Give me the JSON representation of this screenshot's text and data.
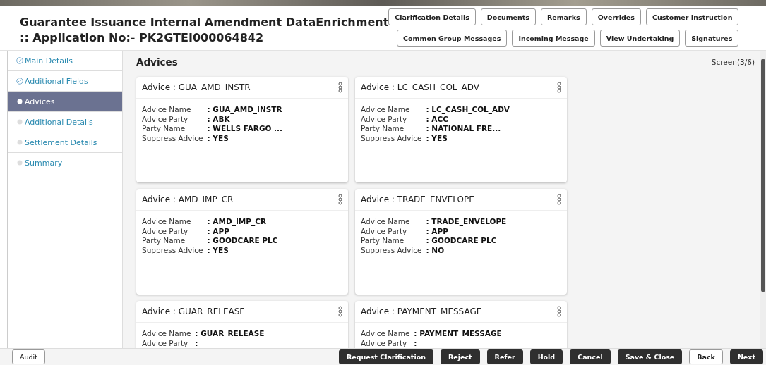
{
  "header": {
    "title": "Guarantee Issuance Internal Amendment DataEnrichment",
    "subtitle": ":: Application No:- PK2GTEI000064842",
    "button_rows": [
      [
        "Clarification Details",
        "Documents",
        "Remarks",
        "Overrides",
        "Customer Instruction"
      ],
      [
        "Common Group Messages",
        "Incoming Message",
        "View Undertaking",
        "Signatures"
      ]
    ]
  },
  "sidebar": {
    "items": [
      {
        "label": "Main Details",
        "completed": true,
        "selected": false
      },
      {
        "label": "Additional Fields",
        "completed": true,
        "selected": false
      },
      {
        "label": "Advices",
        "completed": false,
        "selected": true
      },
      {
        "label": "Additional Details",
        "completed": false,
        "selected": false
      },
      {
        "label": "Settlement Details",
        "completed": false,
        "selected": false
      },
      {
        "label": "Summary",
        "completed": false,
        "selected": false
      }
    ]
  },
  "content": {
    "title": "Advices",
    "screen": "Screen(3/6)",
    "cards": [
      {
        "title": "Advice : GUA_AMD_INSTR",
        "fields": [
          {
            "label": "Advice Name",
            "value": ": GUA_AMD_INSTR"
          },
          {
            "label": "Advice Party",
            "value": ": ABK"
          },
          {
            "label": "Party Name",
            "value": ": WELLS FARGO ..."
          },
          {
            "label": "Suppress Advice",
            "value": ": YES"
          }
        ]
      },
      {
        "title": "Advice : LC_CASH_COL_ADV",
        "fields": [
          {
            "label": "Advice Name",
            "value": ": LC_CASH_COL_ADV"
          },
          {
            "label": "Advice Party",
            "value": ": ACC"
          },
          {
            "label": "Party Name",
            "value": ": NATIONAL FRE..."
          },
          {
            "label": "Suppress Advice",
            "value": ": YES"
          }
        ]
      },
      {
        "title": "Advice : AMD_IMP_CR",
        "fields": [
          {
            "label": "Advice Name",
            "value": ": AMD_IMP_CR"
          },
          {
            "label": "Advice Party",
            "value": ": APP"
          },
          {
            "label": "Party Name",
            "value": ": GOODCARE PLC"
          },
          {
            "label": "Suppress Advice",
            "value": ": YES"
          }
        ]
      },
      {
        "title": "Advice : TRADE_ENVELOPE",
        "fields": [
          {
            "label": "Advice Name",
            "value": ": TRADE_ENVELOPE"
          },
          {
            "label": "Advice Party",
            "value": ": APP"
          },
          {
            "label": "Party Name",
            "value": ": GOODCARE PLC"
          },
          {
            "label": "Suppress Advice",
            "value": ": NO"
          }
        ]
      },
      {
        "title": "Advice : GUAR_RELEASE",
        "fields": [
          {
            "label": "Advice Name",
            "value": ": GUAR_RELEASE"
          },
          {
            "label": "Advice Party",
            "value": ":"
          }
        ]
      },
      {
        "title": "Advice : PAYMENT_MESSAGE",
        "fields": [
          {
            "label": "Advice Name",
            "value": ": PAYMENT_MESSAGE"
          },
          {
            "label": "Advice Party",
            "value": ":"
          }
        ]
      }
    ]
  },
  "footer": {
    "buttons": [
      {
        "label": "Audit",
        "kind": "outline"
      },
      {
        "label": "Request Clarification",
        "kind": "primary"
      },
      {
        "label": "Reject",
        "kind": "primary"
      },
      {
        "label": "Refer",
        "kind": "primary"
      },
      {
        "label": "Hold",
        "kind": "primary"
      },
      {
        "label": "Cancel",
        "kind": "primary"
      },
      {
        "label": "Save & Close",
        "kind": "primary"
      },
      {
        "label": "Back",
        "kind": "outline"
      },
      {
        "label": "Next",
        "kind": "primary"
      }
    ]
  }
}
